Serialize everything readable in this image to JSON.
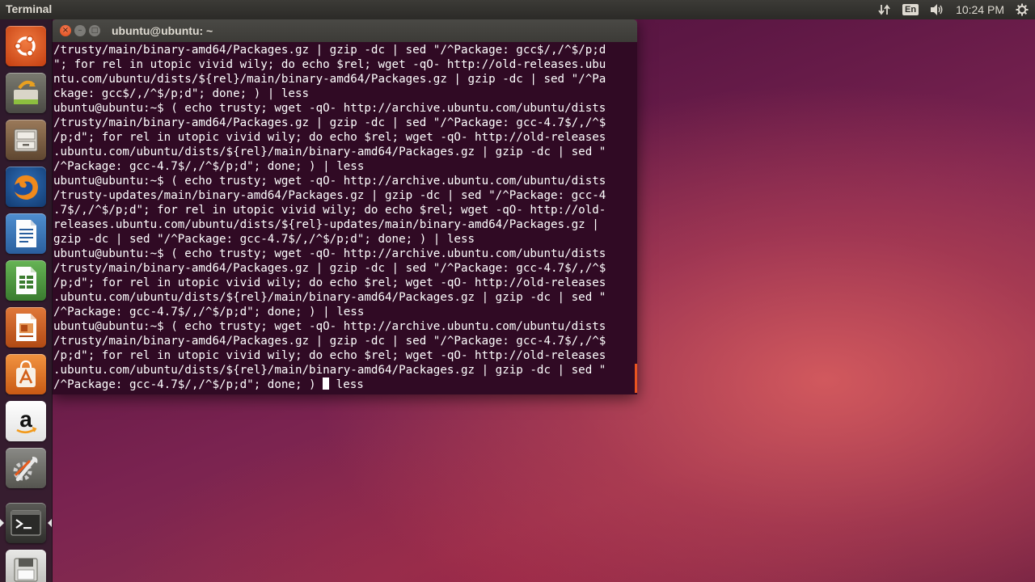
{
  "top_panel": {
    "app_title": "Terminal",
    "language": "En",
    "time": "10:24 PM",
    "indicators": [
      "network-icon",
      "keyboard-language-icon",
      "volume-icon",
      "clock",
      "settings-gear-icon"
    ]
  },
  "launcher": {
    "items": [
      {
        "name": "dash-home",
        "icon": "ubuntu-logo-icon",
        "active": false
      },
      {
        "name": "system-backup",
        "icon": "backup-icon",
        "active": false
      },
      {
        "name": "files",
        "icon": "file-cabinet-icon",
        "active": false
      },
      {
        "name": "firefox",
        "icon": "firefox-icon",
        "active": false
      },
      {
        "name": "libreoffice-writer",
        "icon": "writer-document-icon",
        "active": false
      },
      {
        "name": "libreoffice-calc",
        "icon": "calc-spreadsheet-icon",
        "active": false
      },
      {
        "name": "libreoffice-impress",
        "icon": "impress-presentation-icon",
        "active": false
      },
      {
        "name": "ubuntu-software-center",
        "icon": "software-center-icon",
        "active": false
      },
      {
        "name": "amazon",
        "icon": "amazon-icon",
        "active": false
      },
      {
        "name": "system-settings",
        "icon": "settings-wrench-icon",
        "active": false
      },
      {
        "name": "terminal",
        "icon": "terminal-icon",
        "active": true
      },
      {
        "name": "disk-drive",
        "icon": "disk-drive-icon",
        "active": false
      }
    ],
    "colors": {
      "ubuntu": "#e05a1c",
      "amazon": "#ffffff",
      "terminal": "#2e2e2e"
    }
  },
  "window": {
    "title": "ubuntu@ubuntu: ~",
    "buttons": {
      "close": "×",
      "minimize": "–",
      "maximize": "□"
    }
  },
  "terminal": {
    "background": "#300a24",
    "lines": [
      "/trusty/main/binary-amd64/Packages.gz | gzip -dc | sed \"/^Package: gcc$/,/^$/p;d",
      "\"; for rel in utopic vivid wily; do echo $rel; wget -qO- http://old-releases.ubu",
      "ntu.com/ubuntu/dists/${rel}/main/binary-amd64/Packages.gz | gzip -dc | sed \"/^Pa",
      "ckage: gcc$/,/^$/p;d\"; done; ) | less",
      "ubuntu@ubuntu:~$ ( echo trusty; wget -qO- http://archive.ubuntu.com/ubuntu/dists",
      "/trusty/main/binary-amd64/Packages.gz | gzip -dc | sed \"/^Package: gcc-4.7$/,/^$",
      "/p;d\"; for rel in utopic vivid wily; do echo $rel; wget -qO- http://old-releases",
      ".ubuntu.com/ubuntu/dists/${rel}/main/binary-amd64/Packages.gz | gzip -dc | sed \"",
      "/^Package: gcc-4.7$/,/^$/p;d\"; done; ) | less",
      "ubuntu@ubuntu:~$ ( echo trusty; wget -qO- http://archive.ubuntu.com/ubuntu/dists",
      "/trusty-updates/main/binary-amd64/Packages.gz | gzip -dc | sed \"/^Package: gcc-4",
      ".7$/,/^$/p;d\"; for rel in utopic vivid wily; do echo $rel; wget -qO- http://old-",
      "releases.ubuntu.com/ubuntu/dists/${rel}-updates/main/binary-amd64/Packages.gz |",
      "gzip -dc | sed \"/^Package: gcc-4.7$/,/^$/p;d\"; done; ) | less",
      "ubuntu@ubuntu:~$ ( echo trusty; wget -qO- http://archive.ubuntu.com/ubuntu/dists",
      "/trusty/main/binary-amd64/Packages.gz | gzip -dc | sed \"/^Package: gcc-4.7$/,/^$",
      "/p;d\"; for rel in utopic vivid wily; do echo $rel; wget -qO- http://old-releases",
      ".ubuntu.com/ubuntu/dists/${rel}/main/binary-amd64/Packages.gz | gzip -dc | sed \"",
      "/^Package: gcc-4.7$/,/^$/p;d\"; done; ) | less",
      "ubuntu@ubuntu:~$ ( echo trusty; wget -qO- http://archive.ubuntu.com/ubuntu/dists",
      "/trusty/main/binary-amd64/Packages.gz | gzip -dc | sed \"/^Package: gcc-4.7$/,/^$",
      "/p;d\"; for rel in utopic vivid wily; do echo $rel; wget -qO- http://old-releases",
      ".ubuntu.com/ubuntu/dists/${rel}/main/binary-amd64/Packages.gz | gzip -dc | sed \""
    ],
    "current_line_before_cursor": "/^Package: gcc-4.7$/,/^$/p;d\"; done; ) ",
    "current_line_after_cursor": " less"
  }
}
